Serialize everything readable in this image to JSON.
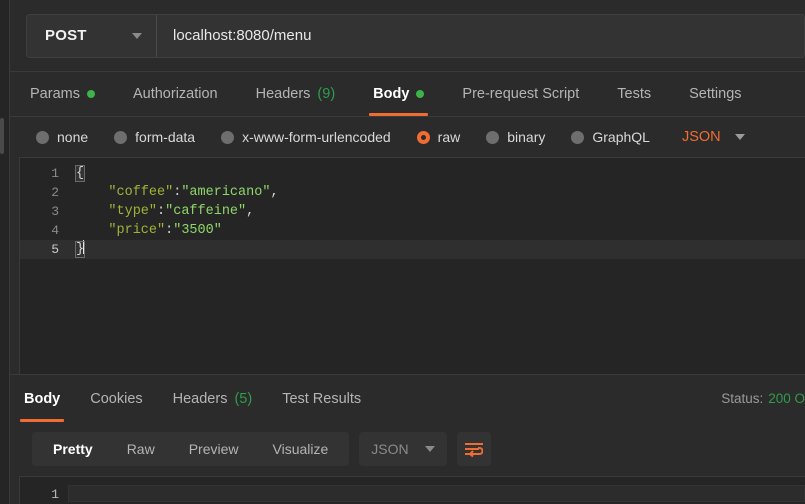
{
  "request": {
    "method": "POST",
    "url": "localhost:8080/menu",
    "tabs": [
      {
        "label": "Params",
        "indicator": "dot",
        "active": false
      },
      {
        "label": "Authorization",
        "indicator": "",
        "active": false
      },
      {
        "label": "Headers",
        "count": "(9)",
        "active": false
      },
      {
        "label": "Body",
        "indicator": "dot",
        "active": true
      },
      {
        "label": "Pre-request Script",
        "indicator": "",
        "active": false
      },
      {
        "label": "Tests",
        "indicator": "",
        "active": false
      },
      {
        "label": "Settings",
        "indicator": "",
        "active": false
      }
    ],
    "body_types": [
      {
        "label": "none",
        "selected": false
      },
      {
        "label": "form-data",
        "selected": false
      },
      {
        "label": "x-www-form-urlencoded",
        "selected": false
      },
      {
        "label": "raw",
        "selected": true
      },
      {
        "label": "binary",
        "selected": false
      },
      {
        "label": "GraphQL",
        "selected": false
      }
    ],
    "raw_format": "JSON",
    "editor": {
      "lines": [
        {
          "num": "1",
          "foldable": true,
          "current": false
        },
        {
          "num": "2",
          "foldable": false,
          "current": false
        },
        {
          "num": "3",
          "foldable": false,
          "current": false
        },
        {
          "num": "4",
          "foldable": false,
          "current": false
        },
        {
          "num": "5",
          "foldable": false,
          "current": true
        }
      ],
      "content": {
        "open_brace": "{",
        "close_brace": "}",
        "pairs": [
          {
            "key": "\"coffee\"",
            "colon": ":",
            "value": "\"americano\"",
            "comma": ","
          },
          {
            "key": "\"type\"",
            "colon": ":",
            "value": "\"caffeine\"",
            "comma": ","
          },
          {
            "key": "\"price\"",
            "colon": ":",
            "value": "\"3500\"",
            "comma": ""
          }
        ]
      }
    }
  },
  "response": {
    "tabs": [
      {
        "label": "Body",
        "count": "",
        "active": true
      },
      {
        "label": "Cookies",
        "count": "",
        "active": false
      },
      {
        "label": "Headers",
        "count": "(5)",
        "active": false
      },
      {
        "label": "Test Results",
        "count": "",
        "active": false
      }
    ],
    "status_label": "Status:",
    "status_value": "200 O",
    "views": [
      {
        "label": "Pretty",
        "active": true
      },
      {
        "label": "Raw",
        "active": false
      },
      {
        "label": "Preview",
        "active": false
      },
      {
        "label": "Visualize",
        "active": false
      }
    ],
    "format": "JSON",
    "body_lines": [
      "1"
    ]
  },
  "colors": {
    "accent": "#ef6c33",
    "success": "#2e9e4a",
    "json_key": "#9fb339",
    "json_value": "#8fd76a",
    "editor_bg": "#252525",
    "panel_bg": "#2b2b2b"
  }
}
